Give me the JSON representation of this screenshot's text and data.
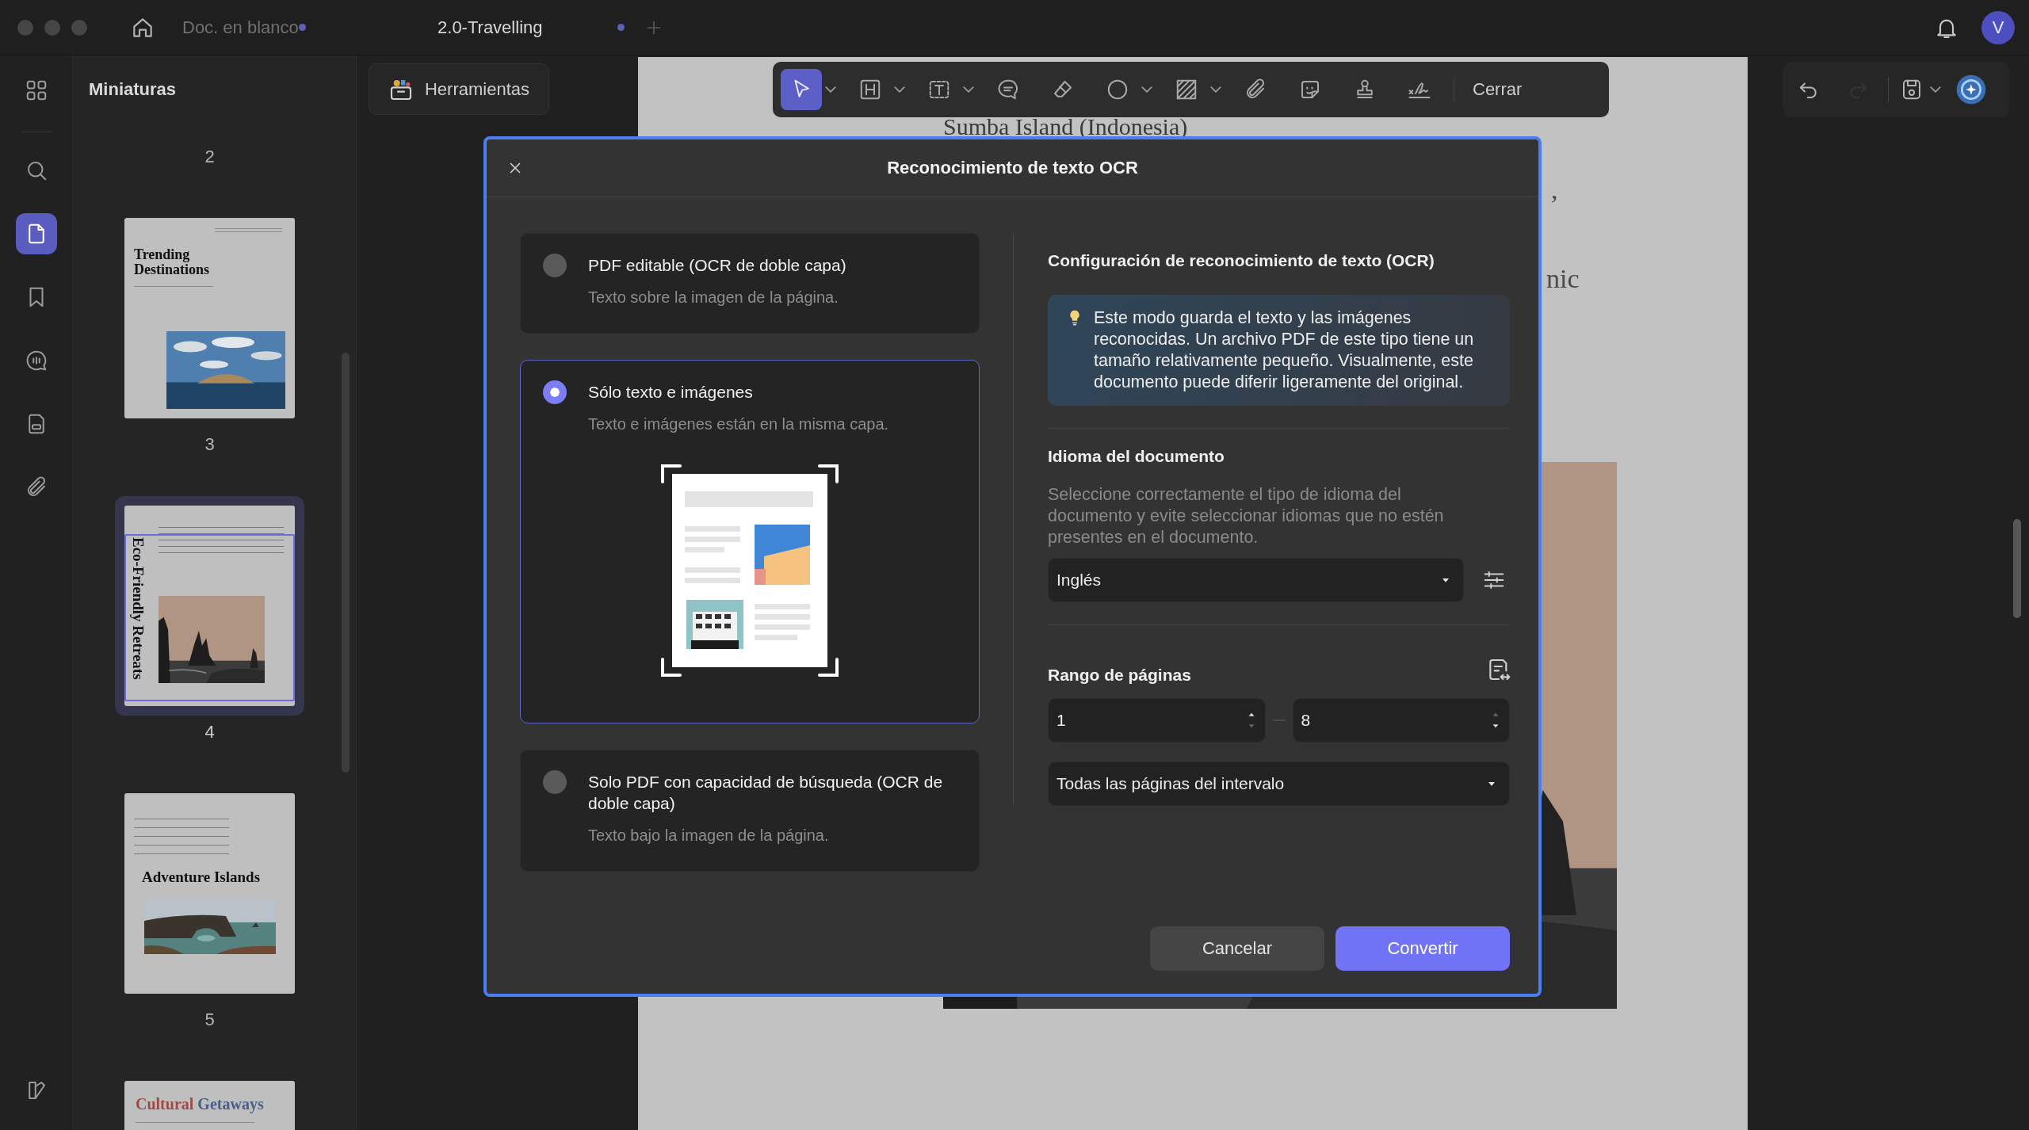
{
  "tabs": [
    {
      "label": "Doc. en blanco",
      "selected": false,
      "unsaved": true
    },
    {
      "label": "2.0-Travelling",
      "selected": true,
      "unsaved": true
    }
  ],
  "account": {
    "initial": "V"
  },
  "rail": {
    "items": [
      {
        "selected": false
      },
      {
        "selected": false
      },
      {
        "selected": true
      },
      {
        "selected": false
      },
      {
        "selected": false
      },
      {
        "selected": false
      },
      {
        "selected": false
      }
    ]
  },
  "thumbnail_panel": {
    "title": "Miniaturas",
    "thumbnails": [
      {
        "number": "2",
        "selected": false
      },
      {
        "number": "3",
        "selected": false,
        "kind": "cover",
        "title_parts": [
          {
            "text": "Trending Destinations"
          }
        ],
        "image": {
          "kind": "picture"
        }
      },
      {
        "number": "4",
        "selected": true,
        "kind": "vertical",
        "title_parts": [
          {
            "text": "Eco-Friendly Retreats"
          }
        ],
        "image": {
          "kind": "picture"
        }
      },
      {
        "number": "5",
        "selected": false,
        "kind": "stacked",
        "title_parts": [
          {
            "text": "Adventure Islands"
          }
        ],
        "image": {
          "kind": "picture"
        }
      },
      {
        "selected": false,
        "kind": "banner",
        "title_parts": [
          {
            "text": "Cultural",
            "color": "#9c4b47"
          },
          {
            "text": "Getaways",
            "color": "#4a5f85"
          }
        ]
      }
    ]
  },
  "tools_button": {
    "label": "Herramientas"
  },
  "toolbar": {
    "tools": [
      {
        "selected": true,
        "menu": true
      },
      {
        "selected": false,
        "menu": true
      },
      {
        "selected": false,
        "menu": true
      },
      {
        "selected": false,
        "menu": false
      },
      {
        "selected": false,
        "menu": false
      },
      {
        "selected": false,
        "menu": true
      },
      {
        "selected": false,
        "menu": true
      },
      {
        "selected": false,
        "menu": false
      },
      {
        "selected": false,
        "menu": false
      },
      {
        "selected": false,
        "menu": false
      },
      {
        "selected": false,
        "menu": false
      }
    ],
    "close_label": "Cerrar"
  },
  "history_toolbar": {
    "items": [
      {
        "disabled": false,
        "menu": false
      },
      {
        "disabled": true,
        "menu": false
      },
      {
        "disabled": false,
        "menu": true
      },
      {
        "disabled": false,
        "menu": false
      }
    ]
  },
  "document": {
    "heading": "Sumba Island (Indonesia)",
    "fragments": [
      ",",
      "nic"
    ],
    "image": {
      "kind": "picture"
    }
  },
  "dialog": {
    "title": "Reconocimiento de texto OCR",
    "options": [
      {
        "title": "PDF editable (OCR de doble capa)",
        "description": "Texto sobre la imagen de la página.",
        "selected": false
      },
      {
        "title": "Sólo texto e imágenes",
        "description": "Texto e imágenes están en la misma capa.",
        "selected": true
      },
      {
        "title": "Solo PDF con capacidad de búsqueda (OCR de doble capa)",
        "description": "Texto bajo la imagen de la página.",
        "selected": false
      }
    ],
    "settings": {
      "heading": "Configuración de reconocimiento de texto (OCR)",
      "tip": "Este modo guarda el texto y las imágenes reconocidas. Un archivo PDF de este tipo tiene un tamaño relativamente pequeño. Visualmente, este documento puede diferir ligeramente del original.",
      "language": {
        "heading": "Idioma del documento",
        "description": "Seleccione correctamente el tipo de idioma del documento y evite seleccionar idiomas que no estén presentes en el documento.",
        "value": "Inglés"
      },
      "page_range": {
        "heading": "Rango de páginas",
        "from": {
          "value": "1",
          "up_disabled": false,
          "down_disabled": true
        },
        "to": {
          "value": "8",
          "up_disabled": true,
          "down_disabled": false
        },
        "filter": "Todas las páginas del intervalo"
      }
    },
    "buttons": [
      {
        "label": "Cancelar",
        "kind": "secondary"
      },
      {
        "label": "Convertir",
        "kind": "primary"
      }
    ]
  }
}
